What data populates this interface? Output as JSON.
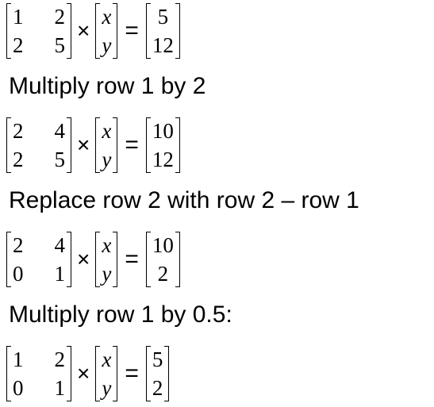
{
  "equations": [
    {
      "matrix": [
        [
          "1",
          "2"
        ],
        [
          "2",
          "5"
        ]
      ],
      "vector": [
        "x",
        "y"
      ],
      "result": [
        "5",
        "12"
      ]
    },
    {
      "matrix": [
        [
          "2",
          "4"
        ],
        [
          "2",
          "5"
        ]
      ],
      "vector": [
        "x",
        "y"
      ],
      "result": [
        "10",
        "12"
      ]
    },
    {
      "matrix": [
        [
          "2",
          "4"
        ],
        [
          "0",
          "1"
        ]
      ],
      "vector": [
        "x",
        "y"
      ],
      "result": [
        "10",
        "2"
      ]
    },
    {
      "matrix": [
        [
          "1",
          "2"
        ],
        [
          "0",
          "1"
        ]
      ],
      "vector": [
        "x",
        "y"
      ],
      "result": [
        "5",
        "2"
      ]
    }
  ],
  "operators": {
    "times": "×",
    "equals": "="
  },
  "steps": [
    "Multiply row 1 by 2",
    "Replace row 2 with row 2 – row 1",
    "Multiply row 1 by 0.5:"
  ]
}
